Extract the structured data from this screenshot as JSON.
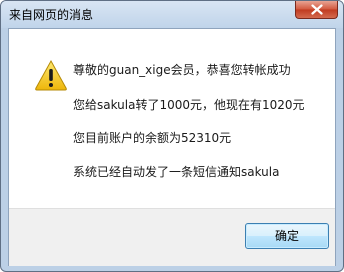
{
  "window": {
    "title": "来自网页的消息"
  },
  "dialog": {
    "icon": "warning-icon",
    "messages": [
      "尊敬的guan_xige会员，恭喜您转帐成功",
      "您给sakula转了1000元，他现在有1020元",
      "您目前账户的余额为52310元",
      "系统已经自动发了一条短信通知sakula"
    ]
  },
  "buttons": {
    "ok_label": "确定"
  },
  "colors": {
    "title_bar": "#c8d9ec",
    "close_button": "#c9462b",
    "warning_yellow": "#f2c40f",
    "ok_border": "#3c7fb1"
  }
}
